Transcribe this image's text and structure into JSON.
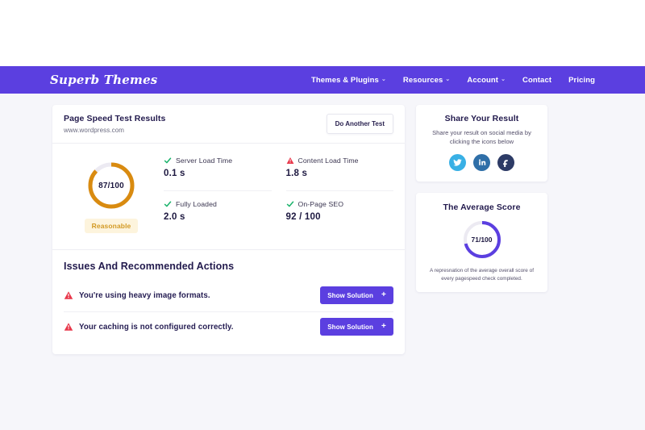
{
  "header": {
    "logo": "Superb Themes",
    "brand_color": "#5b3fe0",
    "nav": [
      {
        "label": "Themes & Plugins",
        "has_caret": true,
        "caret": "⌄"
      },
      {
        "label": "Resources",
        "has_caret": true,
        "caret": "⌄"
      },
      {
        "label": "Account",
        "has_caret": true,
        "caret": "⌄"
      },
      {
        "label": "Contact",
        "has_caret": false,
        "caret": ""
      },
      {
        "label": "Pricing",
        "has_caret": false,
        "caret": ""
      }
    ]
  },
  "results_card": {
    "title": "Page Speed Test Results",
    "url": "www.wordpress.com",
    "do_another_test_label": "Do Another Test",
    "score": {
      "value": 87,
      "max": 100,
      "display": "87/100",
      "rating_label": "Reasonable",
      "ring_color": "#d98b10",
      "ring_track_color": "#eceaf2",
      "badge_bg": "#fdf4dd",
      "badge_text_color": "#d39a25",
      "percent": 87
    },
    "metrics": [
      {
        "name": "Server Load Time",
        "value": "0.1 s",
        "status": "ok",
        "icon": "check-icon"
      },
      {
        "name": "Content Load Time",
        "value": "1.8 s",
        "status": "warn",
        "icon": "warning-triangle-icon"
      },
      {
        "name": "Fully Loaded",
        "value": "2.0 s",
        "status": "ok",
        "icon": "check-icon"
      },
      {
        "name": "On-Page SEO",
        "value": "92 / 100",
        "status": "ok",
        "icon": "check-icon"
      }
    ]
  },
  "issues_section": {
    "title": "Issues And Recommended Actions",
    "button_label": "Show Solution",
    "button_plus": "+",
    "items": [
      {
        "text": "You're using heavy image formats."
      },
      {
        "text": "Your caching is not configured correctly."
      }
    ]
  },
  "share_card": {
    "title": "Share Your Result",
    "subtitle": "Share your result on social media by clicking the icons below",
    "socials": [
      {
        "name": "twitter",
        "color": "#39b0e5"
      },
      {
        "name": "linkedin",
        "color": "#2f6fa8"
      },
      {
        "name": "facebook",
        "color": "#2d3b66"
      }
    ]
  },
  "average_card": {
    "title": "The Average Score",
    "score": {
      "value": 71,
      "max": 100,
      "display": "71/100",
      "ring_color": "#5b3fe0",
      "ring_track_color": "#eceaf2",
      "percent": 71
    },
    "note": "A represnation of the average overall score of every pagespeed check completed."
  },
  "colors": {
    "page_bg": "#f6f6fa",
    "card_bg": "#ffffff",
    "text_dark": "#221a4d",
    "ok_green": "#18b26a",
    "warn_red": "#e8374a"
  }
}
